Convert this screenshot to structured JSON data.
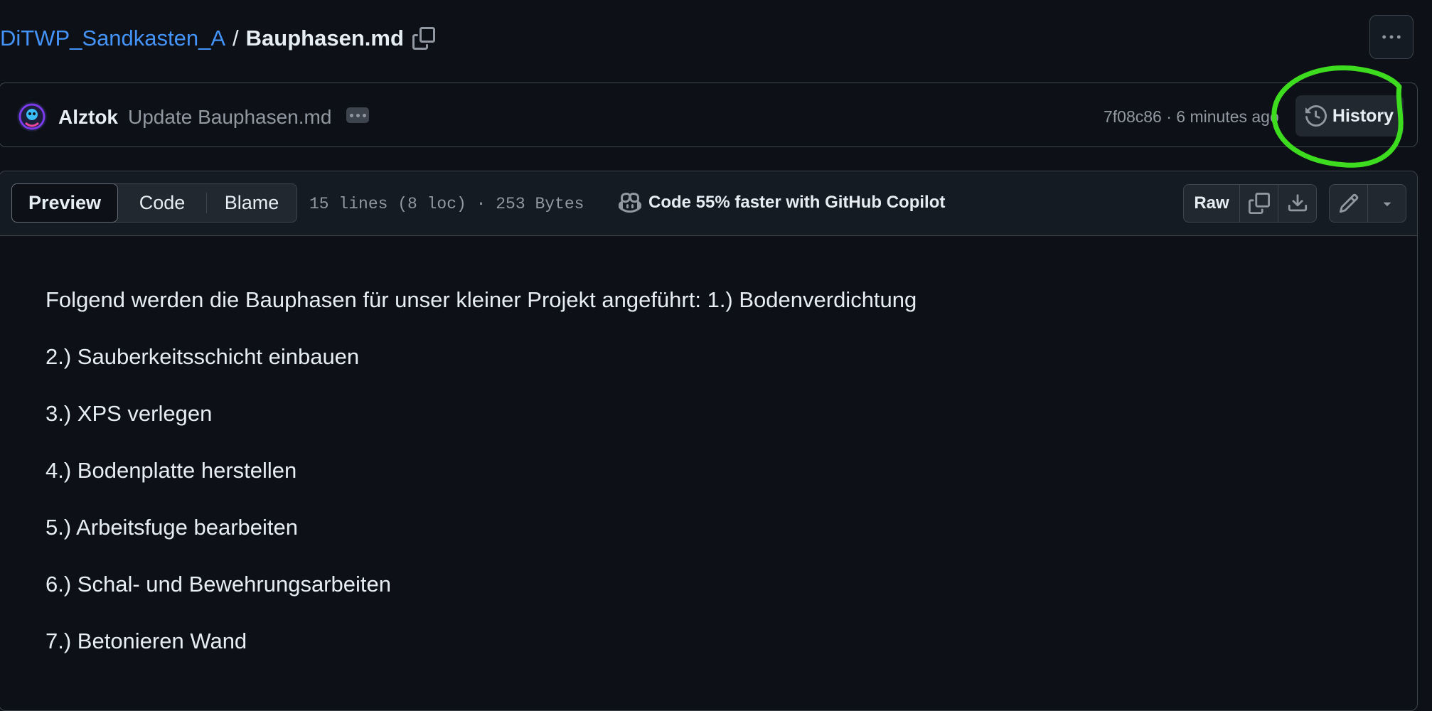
{
  "breadcrumb": {
    "repo": "DiTWP_Sandkasten_A",
    "separator": "/",
    "file": "Bauphasen.md"
  },
  "commit": {
    "author": "Alztok",
    "message": "Update Bauphasen.md",
    "sha_time": "7f08c86 · 6 minutes ago",
    "history_label": "History"
  },
  "file_header": {
    "tabs": [
      "Preview",
      "Code",
      "Blame"
    ],
    "active_tab": "Preview",
    "info": "15 lines (8 loc) · 253 Bytes",
    "copilot": "Code 55% faster with GitHub Copilot",
    "raw_label": "Raw"
  },
  "content": {
    "paragraphs": [
      "Folgend werden die Bauphasen für unser kleiner Projekt angeführt: 1.) Bodenverdichtung",
      "2.) Sauberkeitsschicht einbauen",
      "3.) XPS verlegen",
      "4.) Bodenplatte herstellen",
      "5.) Arbeitsfuge bearbeiten",
      "6.) Schal- und Bewehrungsarbeiten",
      "7.) Betonieren Wand"
    ]
  },
  "colors": {
    "background": "#0d1117",
    "link": "#4493f8",
    "muted": "#9198a1",
    "annotation": "#3ddc1f"
  }
}
